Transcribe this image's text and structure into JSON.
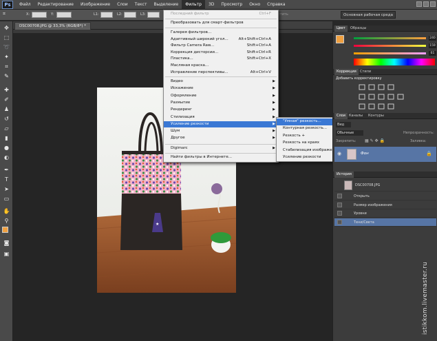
{
  "app": {
    "logo": "Ps"
  },
  "menubar": {
    "items": [
      "Файл",
      "Редактирование",
      "Изображение",
      "Слои",
      "Текст",
      "Выделение",
      "Фильтр",
      "3D",
      "Просмотр",
      "Окно",
      "Справка"
    ],
    "active_index": 6
  },
  "options": {
    "x_label": "X:",
    "x_value": "0,00 %",
    "y_label": "Y:",
    "y_value": "0,00 %",
    "l1_label": "L1:",
    "l1_value": "0,00",
    "l2_label": "L2:",
    "l2_value": "0,00",
    "l3_label": "L3:",
    "l3_value": "0,00",
    "commit_label": "стить",
    "workspace_label": "Основная рабочая среда"
  },
  "document": {
    "tab_title": "DSC00708.JPG @ 33,3% (RGB/8*) *"
  },
  "filter_menu": {
    "last_filter": {
      "label": "Последний фильтр",
      "shortcut": "Ctrl+F"
    },
    "smart": "Преобразовать для смарт-фильтров",
    "group1": [
      {
        "label": "Галерея фильтров...",
        "shortcut": ""
      },
      {
        "label": "Адаптивный широкий угол...",
        "shortcut": "Alt+Shift+Ctrl+A"
      },
      {
        "label": "Фильтр Camera Raw...",
        "shortcut": "Shift+Ctrl+A"
      },
      {
        "label": "Коррекция дисторсии...",
        "shortcut": "Shift+Ctrl+R"
      },
      {
        "label": "Пластика...",
        "shortcut": "Shift+Ctrl+X"
      },
      {
        "label": "Масляная краска...",
        "shortcut": ""
      },
      {
        "label": "Исправление перспективы...",
        "shortcut": "Alt+Ctrl+V"
      }
    ],
    "group2": [
      "Видео",
      "Искажение",
      "Оформление",
      "Размытие",
      "Рендеринг",
      "Стилизация",
      "Усиление резкости",
      "Шум",
      "Другое"
    ],
    "digimarc": "Digimarc",
    "online": "Найти фильтры в Интернете..."
  },
  "sharpen_submenu": [
    "\"Умная\" резкость...",
    "Контурная резкость...",
    "Резкость +",
    "Резкость на краях",
    "Стабилизация изображения...",
    "Усиление резкости"
  ],
  "panels": {
    "color_tabs": [
      "Цвет",
      "Образцы"
    ],
    "color_values": [
      "240",
      "159",
      "61"
    ],
    "adjust_tabs": [
      "Коррекция",
      "Стили"
    ],
    "adjust_title": "Добавить корректировку",
    "layer_tabs": [
      "Слои",
      "Каналы",
      "Контуры"
    ],
    "layer_kind": "Вид",
    "blend_mode": "Обычные",
    "opacity_label": "Непрозрачность:",
    "lock_label": "Закрепить:",
    "fill_label": "Заливка:",
    "layer_name": "Фон",
    "history_tab": "История",
    "history_snapshot": "DSC00708.JPG",
    "history_items": [
      "Открыть",
      "Размер изображения",
      "Уровни",
      "Тени/Света"
    ]
  },
  "watermark": "istikkom.livemaster.ru",
  "colors": {
    "accent": "#3a78d4",
    "foreground": "#f0a040",
    "history_selected": "#5775a5"
  }
}
